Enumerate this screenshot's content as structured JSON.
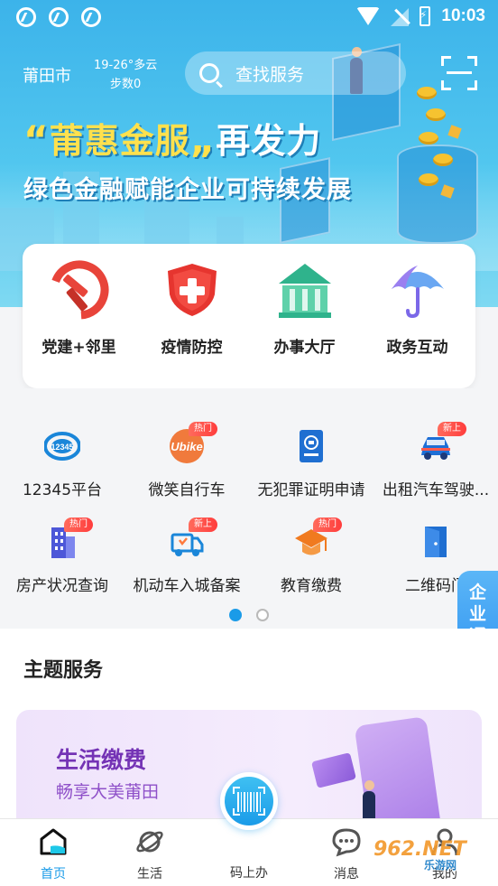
{
  "status_bar": {
    "time": "10:03"
  },
  "header": {
    "city": "莆田市",
    "weather": "19-26°多云",
    "steps": "步数0",
    "search_placeholder": "查找服务"
  },
  "banner": {
    "title_part1": "莆惠金服",
    "title_part2": "再发力",
    "subtitle": "绿色金融赋能企业可持续发展"
  },
  "main_services": [
    {
      "label": "党建+邻里",
      "icon": "party-emblem-icon"
    },
    {
      "label": "疫情防控",
      "icon": "shield-cross-icon"
    },
    {
      "label": "办事大厅",
      "icon": "government-hall-icon"
    },
    {
      "label": "政务互动",
      "icon": "umbrella-icon"
    }
  ],
  "grid_services": [
    {
      "label": "12345平台",
      "icon": "hotline-12345-icon",
      "badge": ""
    },
    {
      "label": "微笑自行车",
      "icon": "bike-icon",
      "badge": "热门"
    },
    {
      "label": "无犯罪证明申请",
      "icon": "certificate-icon",
      "badge": ""
    },
    {
      "label": "出租汽车驾驶...",
      "icon": "taxi-icon",
      "badge": "新上"
    },
    {
      "label": "房产状况查询",
      "icon": "building-icon",
      "badge": "热门"
    },
    {
      "label": "机动车入城备案",
      "icon": "truck-icon",
      "badge": "新上"
    },
    {
      "label": "教育缴费",
      "icon": "graduation-cap-icon",
      "badge": "热门"
    },
    {
      "label": "二维码门",
      "icon": "door-icon",
      "badge": ""
    }
  ],
  "pager": {
    "pages": 2,
    "active": 0
  },
  "float_tab": {
    "label": "企业通",
    "swap": "⇌"
  },
  "theme_section": {
    "title": "主题服务",
    "card_title": "生活缴费",
    "card_subtitle": "畅享大美莆田"
  },
  "bottom_nav": {
    "items": [
      {
        "label": "首页",
        "icon": "home-icon",
        "active": true
      },
      {
        "label": "生活",
        "icon": "planet-icon",
        "active": false
      },
      {
        "label": "消息",
        "icon": "message-icon",
        "active": false
      },
      {
        "label": "我的",
        "icon": "user-icon",
        "active": false
      }
    ],
    "center_label": "码上办"
  },
  "watermark": {
    "main": "962.NET",
    "sub": "乐游网"
  },
  "colors": {
    "primary": "#1a9be8",
    "hero": "#3cb3ea",
    "badge": "#ff3d3d",
    "theme_purple": "#7433b5"
  }
}
